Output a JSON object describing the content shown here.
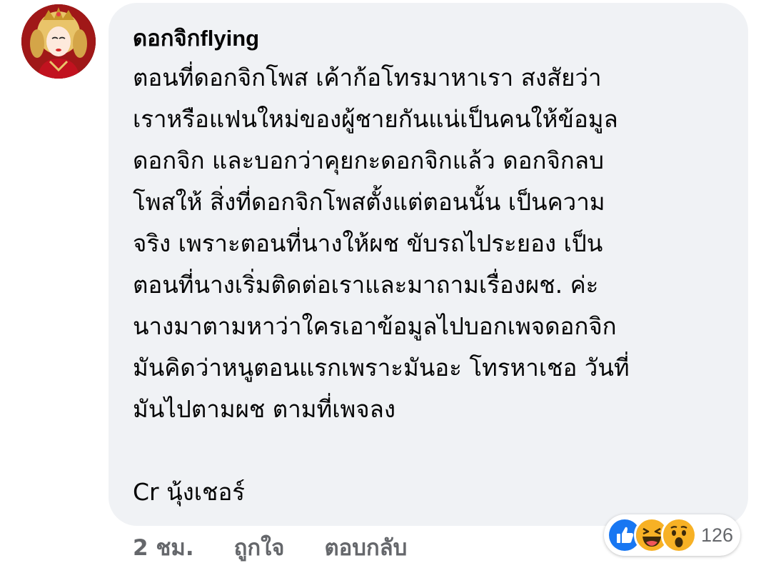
{
  "comment": {
    "author": "ดอกจิกflying",
    "lines": [
      "ตอนที่ดอกจิกโพส เค้าก้อโทรมาหาเรา สงสัยว่า",
      "เราหรือแฟนใหม่ของผู้ชายกันแน่เป็นคนให้ข้อมูล",
      "ดอกจิก และบอกว่าคุยกะดอกจิกแล้ว ดอกจิกลบ",
      "โพสให้ สิ่งที่ดอกจิกโพสตั้งแต่ตอนนั้น เป็นความ",
      "จริง เพราะตอนที่นางให้ผช ขับรถไประยอง เป็น",
      "ตอนที่นางเริ่มติดต่อเราและมาถามเรื่องผช. ค่ะ",
      "นางมาตามหาว่าใครเอาข้อมูลไปบอกเพจดอกจิก",
      "มันคิดว่าหนูตอนแรกเพราะมันอะ โทรหาเชอ วันที่",
      "มันไปตามผช ตามที่เพจลง"
    ],
    "credit": "Cr นุ้งเชอร์"
  },
  "reactions": {
    "icons": [
      "like-icon",
      "haha-icon",
      "wow-icon"
    ],
    "count": "126",
    "colors": {
      "like": "#1877f2",
      "emoji": "#f7b125"
    }
  },
  "actions": {
    "time": "2 ชม.",
    "like_label": "ถูกใจ",
    "reply_label": "ตอบกลับ"
  },
  "avatar": {
    "icon": "profile-avatar"
  }
}
